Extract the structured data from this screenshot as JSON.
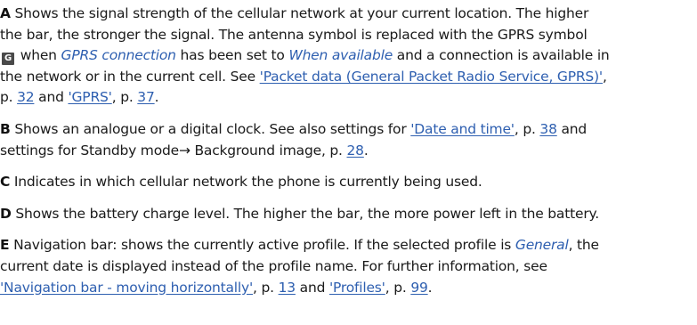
{
  "paragraphs": {
    "a": {
      "lead": "A",
      "l1": " Shows the signal strength of the cellular network at your current location. The higher",
      "l2": "the bar, the stronger the signal. The antenna symbol is replaced with the GPRS symbol",
      "gprs_icon_glyph": "G",
      "l3_a": " when ",
      "l3_it1": "GPRS connection",
      "l3_b": " has been set to ",
      "l3_it2": "When available",
      "l3_c": " and a connection is available in",
      "l4_a": "the network or in the current cell. See ",
      "l4_link": "'Packet data (General Packet Radio Service, GPRS)'",
      "l4_b": ",",
      "l5_a": "p. ",
      "l5_p1": "32",
      "l5_b": " and ",
      "l5_link": "'GPRS'",
      "l5_c": ", p. ",
      "l5_p2": "37",
      "l5_d": "."
    },
    "b": {
      "lead": "B",
      "l1_a": " Shows an analogue or a digital clock. See also settings for ",
      "l1_link": "'Date and time'",
      "l1_b": ", p. ",
      "l1_p": "38",
      "l1_c": " and",
      "l2_a": "settings for Standby mode→ Background image, p. ",
      "l2_p": "28",
      "l2_b": "."
    },
    "c": {
      "lead": "C",
      "l1": " Indicates in which cellular network the phone is currently being used."
    },
    "d": {
      "lead": "D",
      "l1": " Shows the battery charge level. The higher the bar, the more power left in the battery."
    },
    "e": {
      "lead": "E",
      "l1_a": " Navigation bar: shows the currently active profile. If the selected profile is ",
      "l1_it": "General",
      "l1_b": ", the",
      "l2": "current date is displayed instead of the profile name. For further information, see",
      "l3_link1": "'Navigation bar - moving horizontally'",
      "l3_a": ", p. ",
      "l3_p1": "13",
      "l3_b": " and ",
      "l3_link2": "'Profiles'",
      "l3_c": ", p. ",
      "l3_p2": "99",
      "l3_d": "."
    }
  }
}
